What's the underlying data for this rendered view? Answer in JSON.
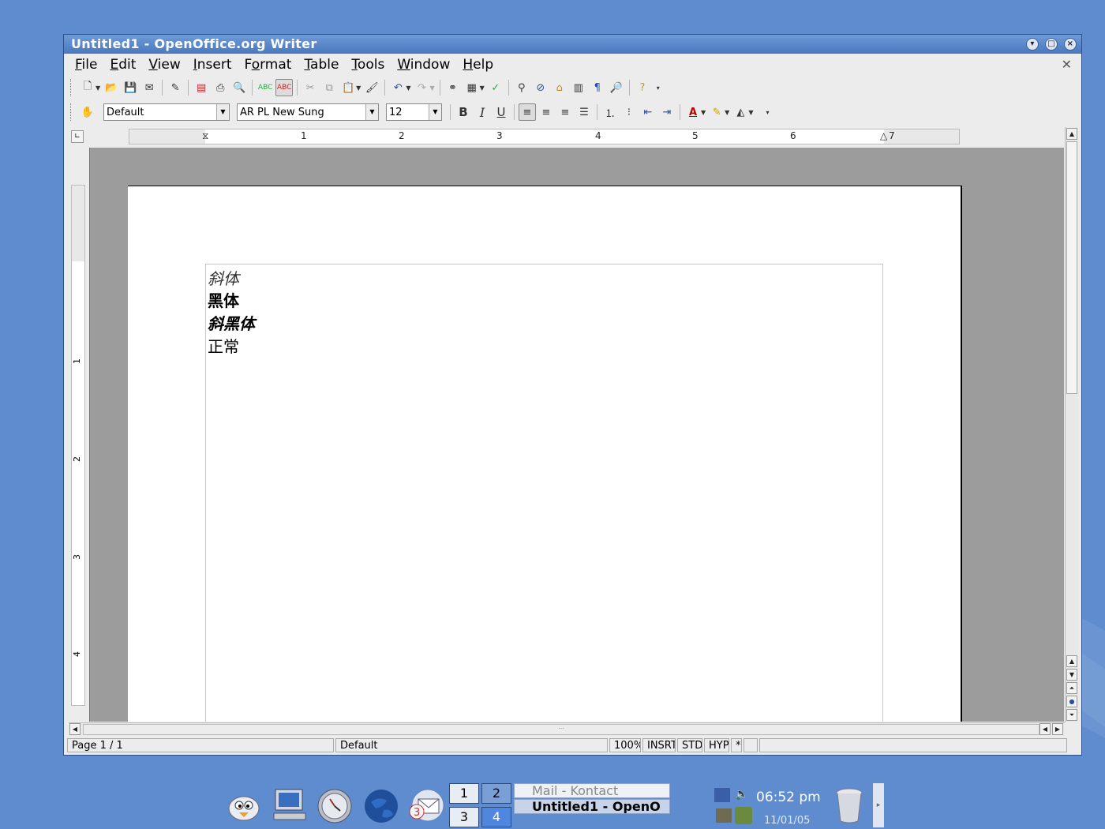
{
  "window": {
    "title": "Untitled1 - OpenOffice.org Writer"
  },
  "menu": [
    {
      "label": "File",
      "u": "F",
      "rest": "ile"
    },
    {
      "label": "Edit",
      "u": "E",
      "rest": "dit"
    },
    {
      "label": "View",
      "u": "V",
      "rest": "iew"
    },
    {
      "label": "Insert",
      "u": "I",
      "rest": "nsert"
    },
    {
      "label": "Format",
      "u": "F",
      "rest": "ormat",
      "pre": ""
    },
    {
      "label": "Table",
      "u": "T",
      "rest": "able"
    },
    {
      "label": "Tools",
      "u": "T",
      "rest": "ools"
    },
    {
      "label": "Window",
      "u": "W",
      "rest": "indow"
    },
    {
      "label": "Help",
      "u": "H",
      "rest": "elp"
    }
  ],
  "formatting": {
    "style": "Default",
    "font": "AR PL New Sung",
    "size": "12",
    "bold": "B",
    "italic": "I",
    "underline": "U"
  },
  "ruler": {
    "h_numbers": [
      "1",
      "2",
      "3",
      "4",
      "5",
      "6",
      "7"
    ],
    "v_numbers": [
      "1",
      "2",
      "3",
      "4"
    ]
  },
  "document": {
    "lines": [
      "斜体",
      "黑体",
      "斜黑体",
      "正常"
    ]
  },
  "status": {
    "page": "Page 1 / 1",
    "style": "Default",
    "zoom": "100%",
    "insert": "INSRT",
    "selection": "STD",
    "hyperlink": "HYP",
    "modified": "*"
  },
  "taskbar": {
    "pager": [
      "1",
      "2",
      "3",
      "4"
    ],
    "tasks": [
      "Mail - Kontact",
      "Untitled1 - OpenO"
    ],
    "clock": "06:52 pm",
    "date": "11/01/05"
  },
  "colors": {
    "desktop": "#5f8ccf",
    "titlebar": "#4a78c0",
    "doc_bg": "#9c9c9c"
  }
}
